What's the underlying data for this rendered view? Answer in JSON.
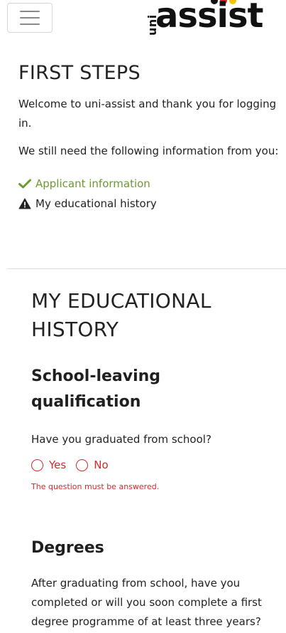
{
  "header": {
    "menu_icon": "hamburger-menu-icon",
    "logo": {
      "small": "uni",
      "main": "assist",
      "dot_colors": [
        "#111111",
        "#d62828",
        "#f2c400"
      ]
    }
  },
  "first_steps": {
    "title": "FIRST STEPS",
    "welcome": "Welcome to uni-assist and thank you for logging in.",
    "need_info": "We still need the following information from you:",
    "items": [
      {
        "label": "Applicant information",
        "icon": "check-icon",
        "status": "done",
        "color": "#6b9a2f"
      },
      {
        "label": "My educational history",
        "icon": "warning-icon",
        "status": "pending",
        "color": "#222222"
      }
    ]
  },
  "educational_history": {
    "title": "MY EDUCATIONAL HISTORY",
    "school": {
      "heading": "School-leaving qualification",
      "question": "Have you graduated from school?",
      "options": [
        "Yes",
        "No"
      ],
      "error": "The question must be answered.",
      "error_color": "#d42a2a"
    },
    "degrees": {
      "heading": "Degrees",
      "question": "After graduating from school, have you completed or will you soon complete a first degree programme of at least three years?"
    }
  }
}
